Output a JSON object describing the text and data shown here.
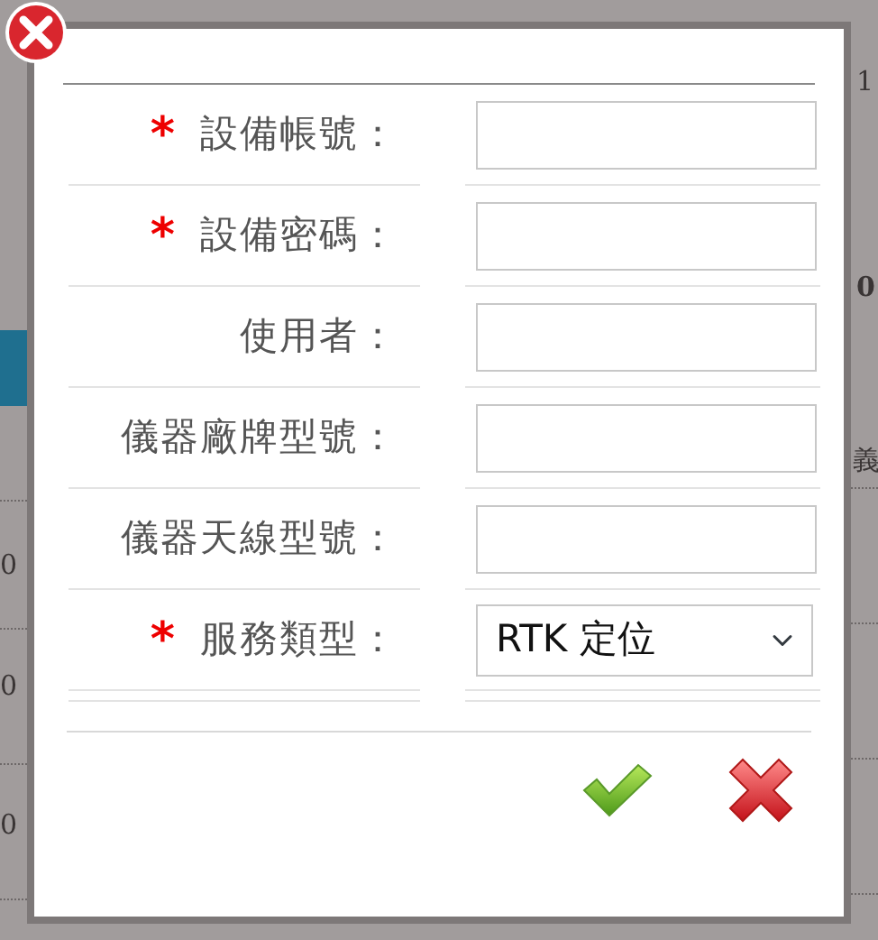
{
  "background": {
    "left_texts": [
      "0",
      "0",
      "0"
    ],
    "right_texts": [
      "1",
      "0",
      "義"
    ]
  },
  "dialog": {
    "fields": [
      {
        "label": "設備帳號：",
        "required": true,
        "kind": "text"
      },
      {
        "label": "設備密碼：",
        "required": true,
        "kind": "text"
      },
      {
        "label": "使用者：",
        "required": false,
        "kind": "text"
      },
      {
        "label": "儀器廠牌型號：",
        "required": false,
        "kind": "text"
      },
      {
        "label": "儀器天線型號：",
        "required": false,
        "kind": "text"
      },
      {
        "label": "服務類型：",
        "required": true,
        "kind": "select",
        "value": "RTK 定位"
      }
    ],
    "required_mark": "*"
  }
}
